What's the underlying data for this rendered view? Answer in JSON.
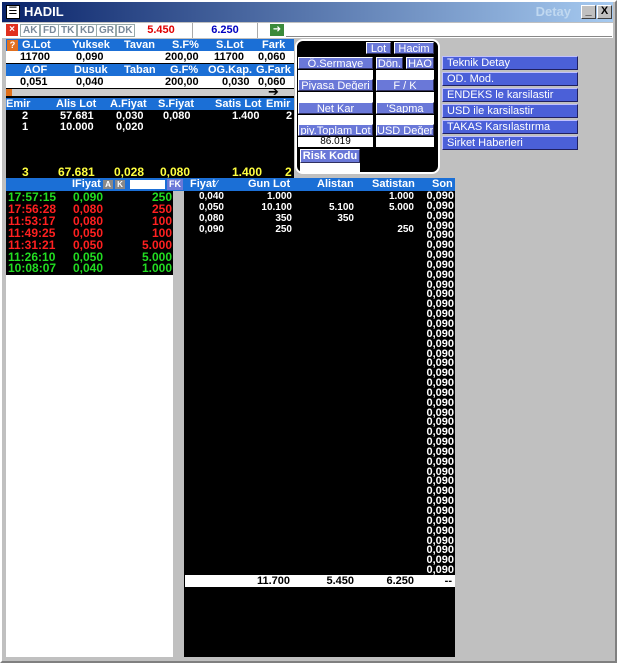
{
  "window": {
    "title": "HADIL",
    "subtitle": "Detay",
    "controls": [
      "_",
      "X"
    ]
  },
  "toolbar": {
    "codes": [
      "AK",
      "FD",
      "TK",
      "KD",
      "GR",
      "DK"
    ],
    "alis": "5.450",
    "satis": "6.250"
  },
  "summary": {
    "headers1": [
      "G.Lot",
      "Yuksek",
      "Tavan",
      "S.F%",
      "S.Lot",
      "Fark"
    ],
    "values1": [
      "11700",
      "0,090",
      "",
      "200,00",
      "11700",
      "0,060"
    ],
    "headers2": [
      "AOF",
      "Dusuk",
      "Taban",
      "G.F%",
      "OG.Kap.",
      "G.Fark"
    ],
    "values2": [
      "0,051",
      "0,040",
      "",
      "200,00",
      "0,030",
      "0,060"
    ],
    "progress_fraction": 0.02
  },
  "emir": {
    "headers": [
      "Emir",
      "Alis Lot",
      "A.Fiyat",
      "S.Fiyat",
      "Satis Lot",
      "Emir"
    ],
    "rows": [
      [
        "2",
        "57.681",
        "0,030",
        "0,080",
        "1.400",
        "2"
      ],
      [
        "1",
        "10.000",
        "0,020",
        "",
        "",
        ""
      ]
    ],
    "totals": [
      "3",
      "67.681",
      "0,028",
      "0,080",
      "1.400",
      "2"
    ]
  },
  "popup": {
    "buttons": {
      "lot": "Lot",
      "hacim": "Hacim",
      "osermaye": "Ö.Sermaye",
      "don": "Dön.",
      "hao": "HAO",
      "piyasa": "Piyasa Değeri",
      "fk": "F / K",
      "netkar": "Net Kar",
      "sapma": "'Sapma",
      "piytoplam": "piy.Toplam Lot",
      "usddegeri": "USD Değeri"
    },
    "piytoplam_value": "86.019",
    "risk_label": "Risk Kodu"
  },
  "side_menu": [
    "Teknik Detay",
    "OD. Mod.",
    "ENDEKS le karsilastir",
    "USD ile karsilastir",
    "TAKAS Karsılastırma",
    "Sirket Haberleri"
  ],
  "trades": {
    "header": "IFiyat",
    "tags": [
      "A",
      "K"
    ],
    "fk": "FK",
    "rows": [
      {
        "time": "17:57:15",
        "price": "0,090",
        "lot": "250",
        "dir": "up"
      },
      {
        "time": "17:56:28",
        "price": "0,080",
        "lot": "250",
        "dir": "down"
      },
      {
        "time": "11:53:17",
        "price": "0,080",
        "lot": "100",
        "dir": "down"
      },
      {
        "time": "11:49:25",
        "price": "0,050",
        "lot": "100",
        "dir": "down"
      },
      {
        "time": "11:31:21",
        "price": "0,050",
        "lot": "5.000",
        "dir": "down"
      },
      {
        "time": "11:26:10",
        "price": "0,050",
        "lot": "5.000",
        "dir": "up"
      },
      {
        "time": "10:08:07",
        "price": "0,040",
        "lot": "1.000",
        "dir": "up"
      }
    ]
  },
  "depth": {
    "headers": [
      "Fiyat",
      "Gun Lot",
      "Alistan",
      "Satistan",
      "Son"
    ],
    "rows": [
      [
        "0,040",
        "1.000",
        "",
        "1.000"
      ],
      [
        "0,050",
        "10.100",
        "5.100",
        "5.000"
      ],
      [
        "0,080",
        "350",
        "350",
        ""
      ],
      [
        "0,090",
        "250",
        "",
        "250"
      ]
    ],
    "son": [
      "0,090",
      "0,090",
      "0,090",
      "0,090",
      "0,090",
      "0,090",
      "0,090",
      "0,090",
      "0,090",
      "0,090",
      "0,090",
      "0,090",
      "0,090",
      "0,090",
      "0,090",
      "0,090",
      "0,090",
      "0,090",
      "0,090",
      "0,090",
      "0,090",
      "0,090",
      "0,090",
      "0,090",
      "0,090",
      "0,090",
      "0,090",
      "0,090",
      "0,090",
      "0,090",
      "0,090",
      "0,090",
      "0,090",
      "0,090",
      "0,090",
      "0,090",
      "0,090",
      "0,090",
      "0,090"
    ],
    "totals": [
      "11.700",
      "5.450",
      "6.250",
      "--"
    ]
  },
  "colors": {
    "up": "#22dd22",
    "down": "#ff2020",
    "yellow": "#ffff40",
    "header_blue": "#1b6fd6"
  }
}
